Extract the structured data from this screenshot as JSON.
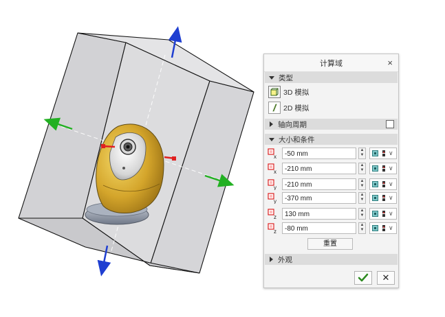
{
  "dialog": {
    "title": "计算域",
    "close_glyph": "×",
    "sections": {
      "type": "类型",
      "axial_period": "轴向周期",
      "size_conditions": "大小和条件",
      "appearance": "外观"
    },
    "type_options": [
      "3D 模拟",
      "2D 模拟"
    ],
    "axial_period_checked": false,
    "size_rows": [
      {
        "axis": "x",
        "value": "-50 mm"
      },
      {
        "axis": "x",
        "value": "-210 mm"
      },
      {
        "axis": "y",
        "value": "-210 mm"
      },
      {
        "axis": "y",
        "value": "-370 mm"
      },
      {
        "axis": "z",
        "value": "130 mm"
      },
      {
        "axis": "z",
        "value": "-80 mm"
      }
    ],
    "reset_label": "重置",
    "ok_glyph": "✔",
    "cancel_glyph": "✕"
  },
  "colors": {
    "axis_x": "#22b022",
    "axis_y": "#1f3fd1",
    "axis_z": "#e02020",
    "box_fill": "#d7d7d9",
    "model_yellow": "#d7ab2c",
    "base_gray": "#8f98a7"
  },
  "icons": {
    "type_3d": "3d-sim-icon",
    "type_2d": "2d-sim-icon",
    "axis_dimension": "axis-dimension-icon",
    "snap": "snap-point-icon"
  }
}
